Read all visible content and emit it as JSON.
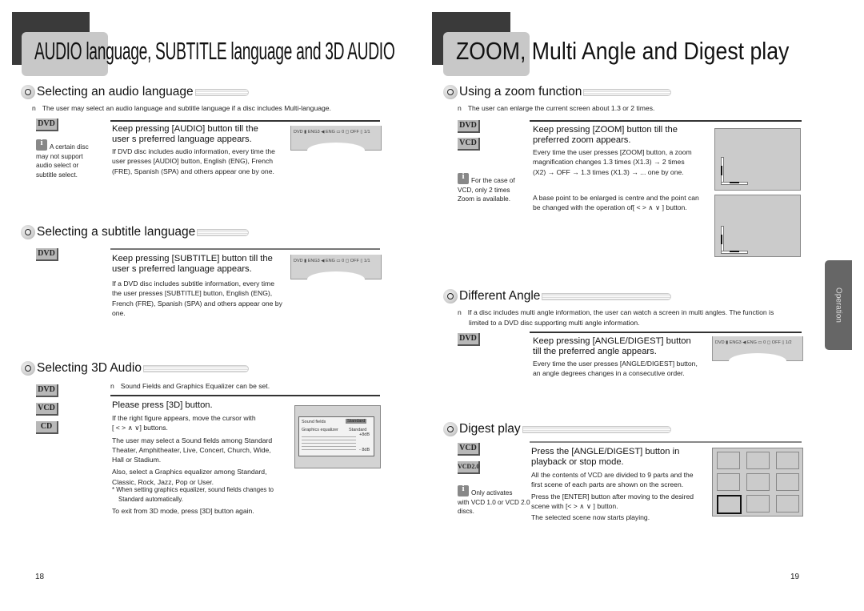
{
  "left_page": {
    "title": "AUDIO language, SUBTITLE language and 3D AUDIO",
    "page_number": "18",
    "sections": {
      "audio": {
        "heading": "Selecting an audio language",
        "note_bullet": "n",
        "note": "The user may select an audio language and subtitle language if a disc includes Multi-language.",
        "discs": [
          "DVD"
        ],
        "side_note": [
          "A certain disc",
          "may not support",
          "audio select or",
          "subtitle select."
        ],
        "lead": [
          "Keep pressing [AUDIO] button till the",
          "user s preferred language appears."
        ],
        "body": [
          "If DVD disc includes audio information, every time the",
          "user presses [AUDIO] button, English (ENG), French",
          "(FRE), Spanish (SPA) and others appear one by one."
        ],
        "osd": "DVD ▮ ENG3 ◀ ENG  ▭ 0 ◻ OFF ▯ 1/1"
      },
      "subtitle": {
        "heading": "Selecting a subtitle language",
        "discs": [
          "DVD"
        ],
        "lead": [
          "Keep pressing [SUBTITLE] button till the",
          "user s preferred language appears."
        ],
        "body": [
          "If a DVD disc includes subtitle information, every time",
          "the user presses [SUBTITLE] button, English (ENG),",
          "French (FRE), Spanish (SPA)  and others appear one by",
          "one."
        ],
        "osd": "DVD ▮ ENG3 ◀ ENG  ▭ 0 ◻ OFF ▯ 1/1"
      },
      "audio3d": {
        "heading": "Selecting 3D Audio",
        "note_bullet": "n",
        "note": "Sound Fields and Graphics Equalizer can be set.",
        "discs": [
          "DVD",
          "VCD",
          "CD"
        ],
        "lead": "Please press [3D] button.",
        "body": [
          "If the right figure appears, move the cursor with",
          "[ <  >  ∧  ∨] buttons.",
          "The user may select a  Sound fields  among Standard",
          "Theater, Amphitheater, Live, Concert, Church, Wide,",
          "Hall or Stadium.",
          "Also, select a  Graphics equalizer  among Standard,",
          "Classic, Rock, Jazz, Pop or User."
        ],
        "footnote": [
          "* When setting graphics equalizer, sound fields changes to",
          "Standard  automatically."
        ],
        "exit": "To exit from 3D mode, press [3D] button again.",
        "figure": {
          "sound_fields_label": "Sound fields",
          "sound_fields_value": "Standard",
          "eq_label": "Graphics equalizer",
          "eq_value": "Standard",
          "max_db": "+8dB",
          "min_db": "- 8dB"
        }
      }
    }
  },
  "right_page": {
    "title_bold": "ZOOM,",
    "title_rest": " Multi Angle and Digest play",
    "page_number": "19",
    "side_tab": "Operation",
    "sections": {
      "zoom": {
        "heading": "Using a zoom function",
        "note_bullet": "n",
        "note": "The user can enlarge the current screen about 1.3 or 2 times.",
        "discs": [
          "DVD",
          "VCD"
        ],
        "side_note": [
          "For the case of",
          "VCD, only 2 times",
          "Zoom is available."
        ],
        "lead": [
          "Keep pressing [ZOOM] button till the",
          "preferred zoom appears."
        ],
        "body": [
          "Every time the user presses [ZOOM] button, a zoom",
          "magnification changes 1.3 times (X1.3) →   2 times",
          "(X2)  →  OFF →   1.3 times (X1.3) →   ... one by one."
        ],
        "body2": [
          "A base point to be enlarged is centre and the point can",
          "be changed with the operation of[ <  >  ∧  ∨  ] button."
        ]
      },
      "angle": {
        "heading": "Different Angle",
        "note_bullet": "n",
        "note": [
          "If a disc includes multi angle information, the user can watch a screen in multi angles. The function is",
          "limited to a DVD disc supporting multi angle information."
        ],
        "discs": [
          "DVD"
        ],
        "lead": [
          "Keep pressing [ANGLE/DIGEST] button",
          "till the preferred angle appears."
        ],
        "body": [
          "Every time the user presses [ANGLE/DIGEST] button,",
          "an angle degrees changes in a consecutive order."
        ],
        "osd": "DVD ▮ ENG3 ◀ ENG  ▭ 0 ◻ OFF ▯ 1/2"
      },
      "digest": {
        "heading": "Digest play",
        "discs": [
          "VCD",
          "VCD2.0"
        ],
        "side_note": [
          "Only activates",
          "with VCD 1.0 or VCD 2.0",
          "discs."
        ],
        "lead": [
          "Press the [ANGLE/DIGEST] button in",
          "playback or stop mode."
        ],
        "body": [
          "All the contents of VCD are divided to 9 parts and the",
          "first scene of each parts are shown on the screen.",
          "Press the [ENTER] button after moving to the desired",
          "scene with [<  >  ∧  ∨  ] button.",
          "The selected scene now starts playing."
        ],
        "grid_selected_index": 6
      }
    }
  }
}
